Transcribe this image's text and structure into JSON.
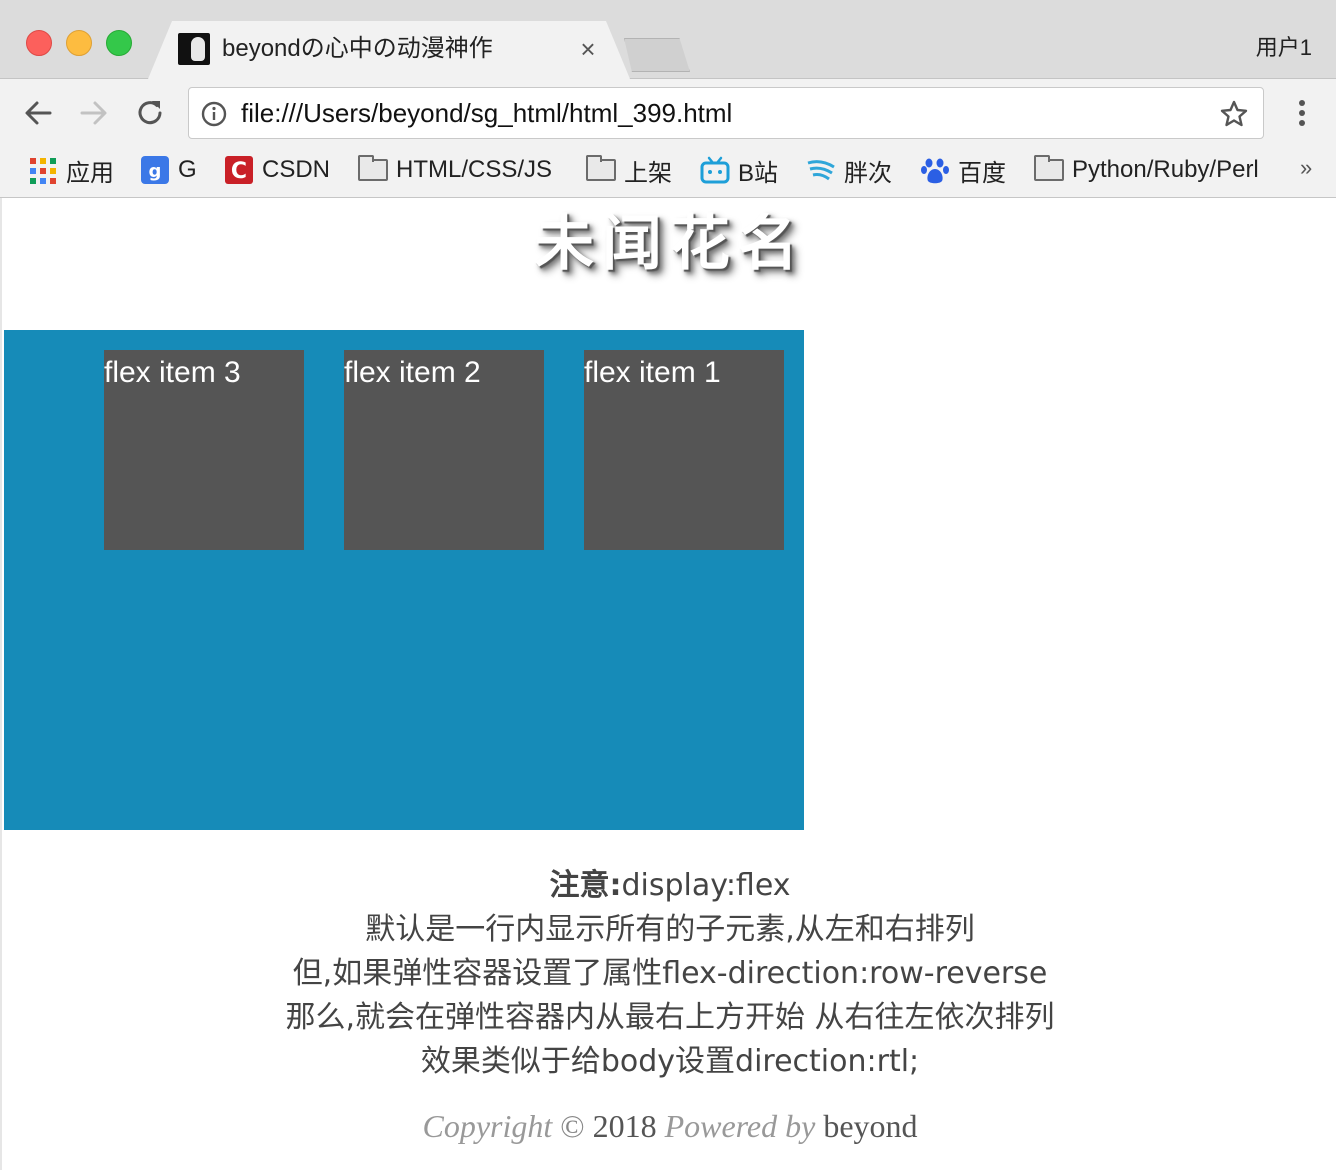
{
  "browser": {
    "tab_title": "beyondの心中の动漫神作",
    "tab_close": "×",
    "profile": "用户1",
    "url": "file:///Users/beyond/sg_html/html_399.html"
  },
  "bookmarks": [
    {
      "label": "应用",
      "icon": "apps-grid-icon"
    },
    {
      "label": "G",
      "icon": "google-icon"
    },
    {
      "label": "CSDN",
      "icon": "csdn-icon"
    },
    {
      "label": "HTML/CSS/JS",
      "icon": "folder-icon"
    },
    {
      "label": "上架",
      "icon": "folder-icon"
    },
    {
      "label": "B站",
      "icon": "bilibili-icon"
    },
    {
      "label": "胖次",
      "icon": "wing-icon"
    },
    {
      "label": "百度",
      "icon": "baidu-paw-icon"
    },
    {
      "label": "Python/Ruby/Perl",
      "icon": "folder-icon"
    }
  ],
  "bookmarks_more": "»",
  "page": {
    "heading": "未闻花名",
    "flex_items": [
      "flex item 1",
      "flex item 2",
      "flex item 3"
    ],
    "note_label": "注意:",
    "note_lines": [
      "display:flex",
      "默认是一行内显示所有的子元素,从左和右排列",
      "但,如果弹性容器设置了属性flex-direction:row-reverse",
      "那么,就会在弹性容器内从最右上方开始 从右往左依次排列",
      "效果类似于给body设置direction:rtl;"
    ],
    "copyright": {
      "prefix": "Copyright",
      "symbol": "©",
      "year": "2018",
      "powered": "Powered by",
      "author": "beyond"
    }
  },
  "colors": {
    "container": "#168bb8",
    "item": "#555555"
  }
}
